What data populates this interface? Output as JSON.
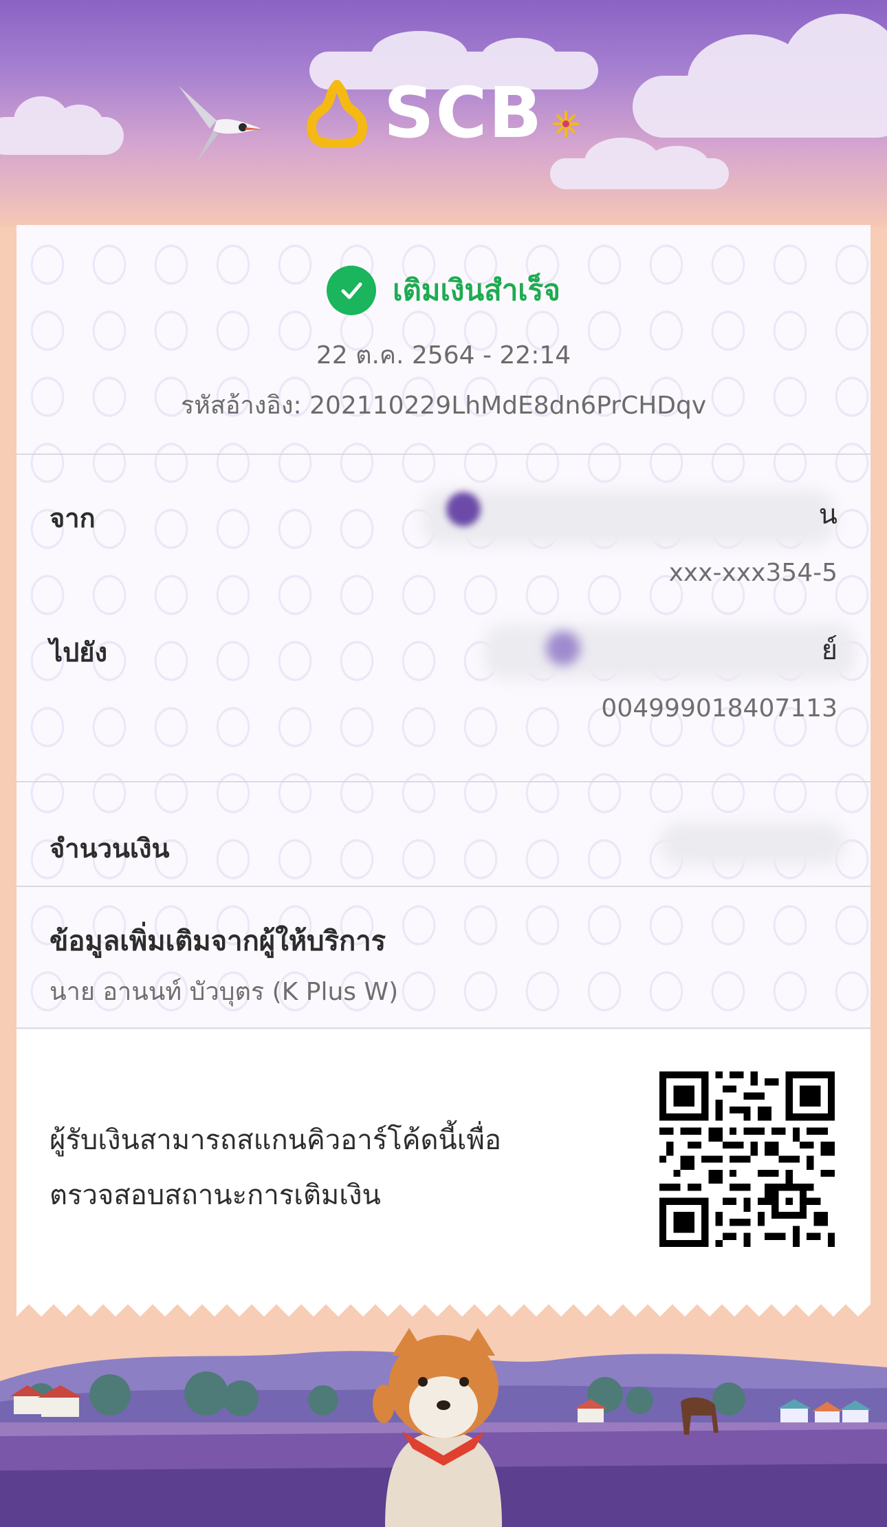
{
  "brand": {
    "name": "SCB"
  },
  "status": {
    "text": "เติมเงินสำเร็จ"
  },
  "datetime": "22 ต.ค. 2564 - 22:14",
  "reference": {
    "label": "รหัสอ้างอิง:",
    "value": "202110229LhMdE8dn6PrCHDqv"
  },
  "from": {
    "label": "จาก",
    "name_suffix": "น",
    "account": "xxx-xxx354-5"
  },
  "to": {
    "label": "ไปยัง",
    "name_suffix": "ย์",
    "account": "004999018407113"
  },
  "amount": {
    "label": "จำนวนเงิน"
  },
  "provider_info": {
    "title": "ข้อมูลเพิ่มเติมจากผู้ให้บริการ",
    "value": "นาย อานนท์ บัวบุตร (K Plus W)"
  },
  "qr_note": {
    "line1": "ผู้รับเงินสามารถสแกนคิวอาร์โค้ดนี้เพื่อ",
    "line2": "ตรวจสอบสถานะการเติมเงิน"
  },
  "icons": [
    "bird-icon",
    "scb-logo-mark",
    "check-icon",
    "qr-code",
    "shiba-dog-illustration"
  ],
  "colors": {
    "success": "#1eab52",
    "brand_purple": "#4e2a84",
    "sky_top": "#8a63c4"
  }
}
